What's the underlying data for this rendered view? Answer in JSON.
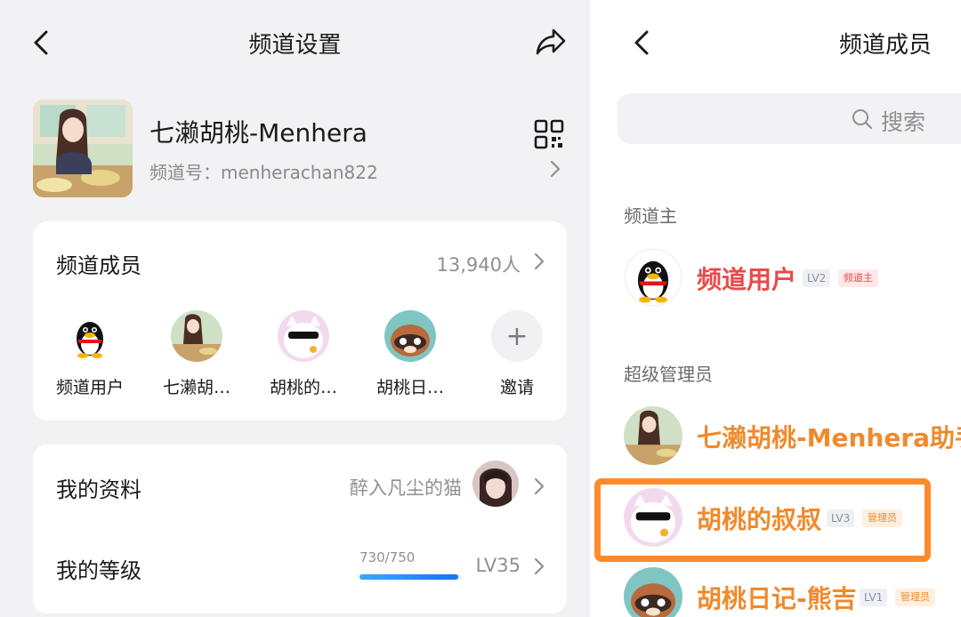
{
  "settings": {
    "title": "频道设置",
    "channel": {
      "name": "七濑胡桃-Menhera",
      "id_label": "频道号：menherachan822"
    },
    "members_row": {
      "label": "频道成员",
      "count": "13,940人"
    },
    "members": [
      {
        "name": "频道用户",
        "avatar": "penguin"
      },
      {
        "name": "七濑胡…",
        "avatar": "anime-girl"
      },
      {
        "name": "胡桃的…",
        "avatar": "cat-sunglasses"
      },
      {
        "name": "胡桃日…",
        "avatar": "raccoon"
      },
      {
        "name": "邀请",
        "avatar": "plus"
      }
    ],
    "profile_row": {
      "label": "我的资料",
      "value": "醉入凡尘的猫"
    },
    "level_row": {
      "label": "我的等级",
      "progress_text": "730/750",
      "progress": 0.973,
      "level": "LV35"
    }
  },
  "members_page": {
    "title": "频道成员",
    "search_placeholder": "搜索",
    "sections": [
      {
        "title": "频道主",
        "items": [
          {
            "name": "频道用户",
            "level": "LV2",
            "role": "频道主",
            "color": "#e84a4a",
            "avatar": "penguin"
          }
        ]
      },
      {
        "title": "超级管理员",
        "items": [
          {
            "name": "七濑胡桃-Menhera助手",
            "level": "",
            "role": "",
            "color": "#ef8a2c",
            "avatar": "anime-girl"
          },
          {
            "name": "胡桃的叔叔",
            "level": "LV3",
            "role": "管理员",
            "color": "#ef8a2c",
            "avatar": "cat-sunglasses"
          },
          {
            "name": "胡桃日记-熊吉",
            "level": "LV1",
            "role": "管理员",
            "color": "#ef8a2c",
            "avatar": "raccoon"
          }
        ]
      }
    ]
  },
  "colors": {
    "owner_red": "#e84a4a",
    "admin_orange": "#ef8a2c",
    "highlight_orange": "#ff8a2a",
    "progress_blue": "#1c6fff"
  }
}
